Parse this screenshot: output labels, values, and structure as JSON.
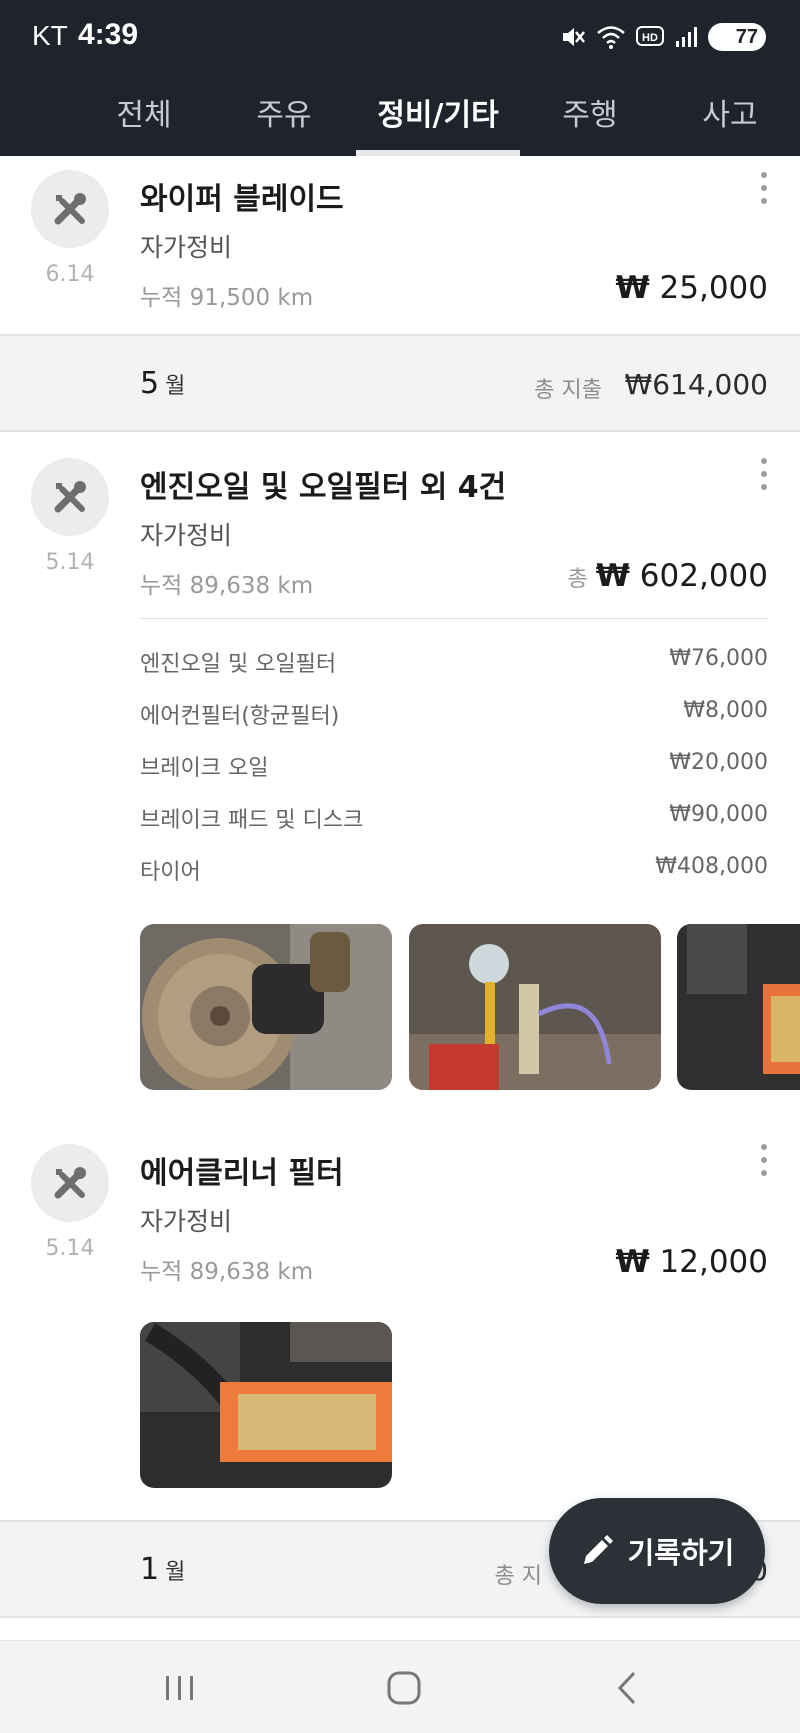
{
  "status_bar": {
    "carrier": "KT",
    "time": "4:39",
    "battery": "77",
    "icons": [
      "mute-vibrate-icon",
      "wifi-icon",
      "hd-voice-icon",
      "signal-icon",
      "battery-icon"
    ]
  },
  "tabs": [
    {
      "label": "전체",
      "active": false
    },
    {
      "label": "주유",
      "active": false
    },
    {
      "label": "정비/기타",
      "active": true
    },
    {
      "label": "주행",
      "active": false
    },
    {
      "label": "사고",
      "active": false
    }
  ],
  "records": [
    {
      "title": "와이퍼 블레이드",
      "type": "자가정비",
      "date": "6.14",
      "odometer": "누적 91,500 km",
      "currency": "₩",
      "amount": "25,000"
    },
    {
      "title": "엔진오일 및 오일필터 외 4건",
      "type": "자가정비",
      "date": "5.14",
      "odometer": "누적 89,638 km",
      "total_label": "총",
      "currency": "₩",
      "amount": "602,000",
      "items": [
        {
          "name": "엔진오일 및 오일필터",
          "price": "₩76,000"
        },
        {
          "name": "에어컨필터(항균필터)",
          "price": "₩8,000"
        },
        {
          "name": "브레이크 오일",
          "price": "₩20,000"
        },
        {
          "name": "브레이크 패드 및 디스크",
          "price": "₩90,000"
        },
        {
          "name": "타이어",
          "price": "₩408,000"
        }
      ],
      "photos": [
        "brake-disc-photo",
        "brake-fluid-photo",
        "air-filter-photo"
      ]
    },
    {
      "title": "에어클리너 필터",
      "type": "자가정비",
      "date": "5.14",
      "odometer": "누적 89,638 km",
      "currency": "₩",
      "amount": "12,000",
      "photos": [
        "air-filter-photo"
      ]
    }
  ],
  "months": [
    {
      "month": "5",
      "unit": "월",
      "spend_label": "총 지출",
      "spend_value": "₩614,000"
    },
    {
      "month": "1",
      "unit": "월",
      "spend_label": "총 지",
      "spend_value": "0"
    }
  ],
  "fab": {
    "label": "기록하기",
    "icon": "pencil-icon"
  },
  "nav": {
    "icons": [
      "recent-apps-icon",
      "home-icon",
      "back-icon"
    ]
  },
  "colors": {
    "header_bg": "#1f242c",
    "band_bg": "#f2f3f5",
    "fab_bg": "#2c3138"
  }
}
